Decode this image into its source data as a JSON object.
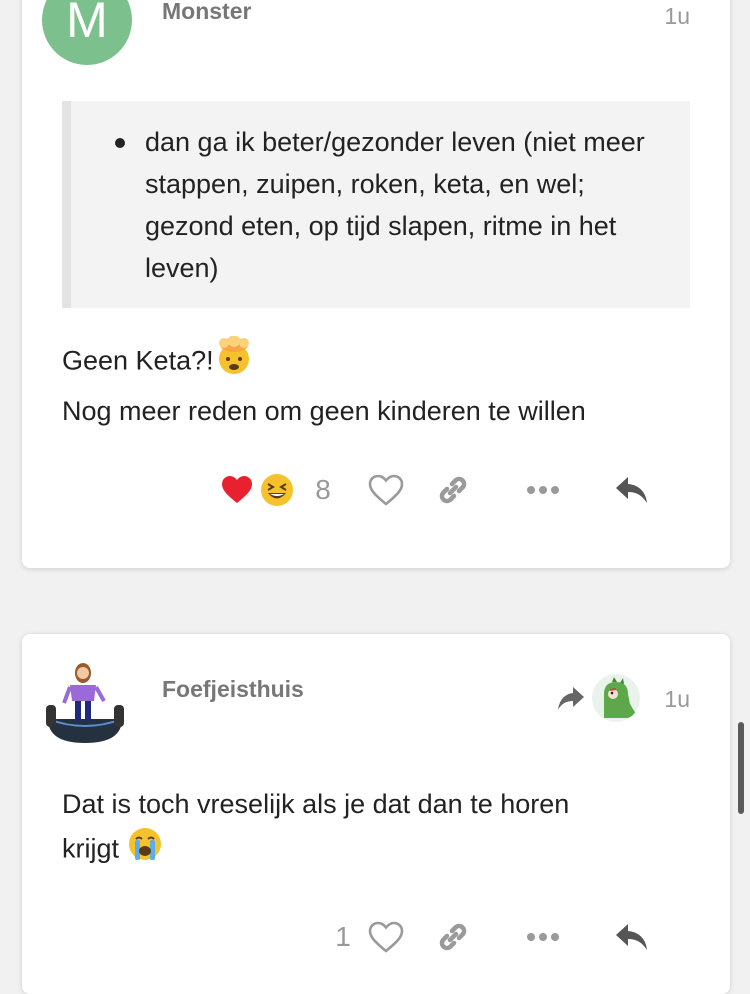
{
  "posts": [
    {
      "username": "Monster",
      "avatar_letter": "M",
      "timestamp": "1u",
      "quote_items": [
        "dan ga ik beter/gezonder leven (niet meer stappen, zuipen, roken, keta, en wel; gezond eten, op tijd slapen, ritme in het leven)"
      ],
      "body_lines": [
        "Geen Keta?!",
        "Nog meer reden om geen kinderen te willen"
      ],
      "reactions_count": "8"
    },
    {
      "username": "Foefjeisthuis",
      "timestamp": "1u",
      "body_lines": [
        "Dat is toch vreselijk als je dat dan te horen",
        "krijgt"
      ],
      "likes_count": "1"
    }
  ],
  "colors": {
    "avatar_green": "#7cc08e",
    "heart_red": "#e8202f",
    "icon_grey": "#9a9a9a"
  }
}
